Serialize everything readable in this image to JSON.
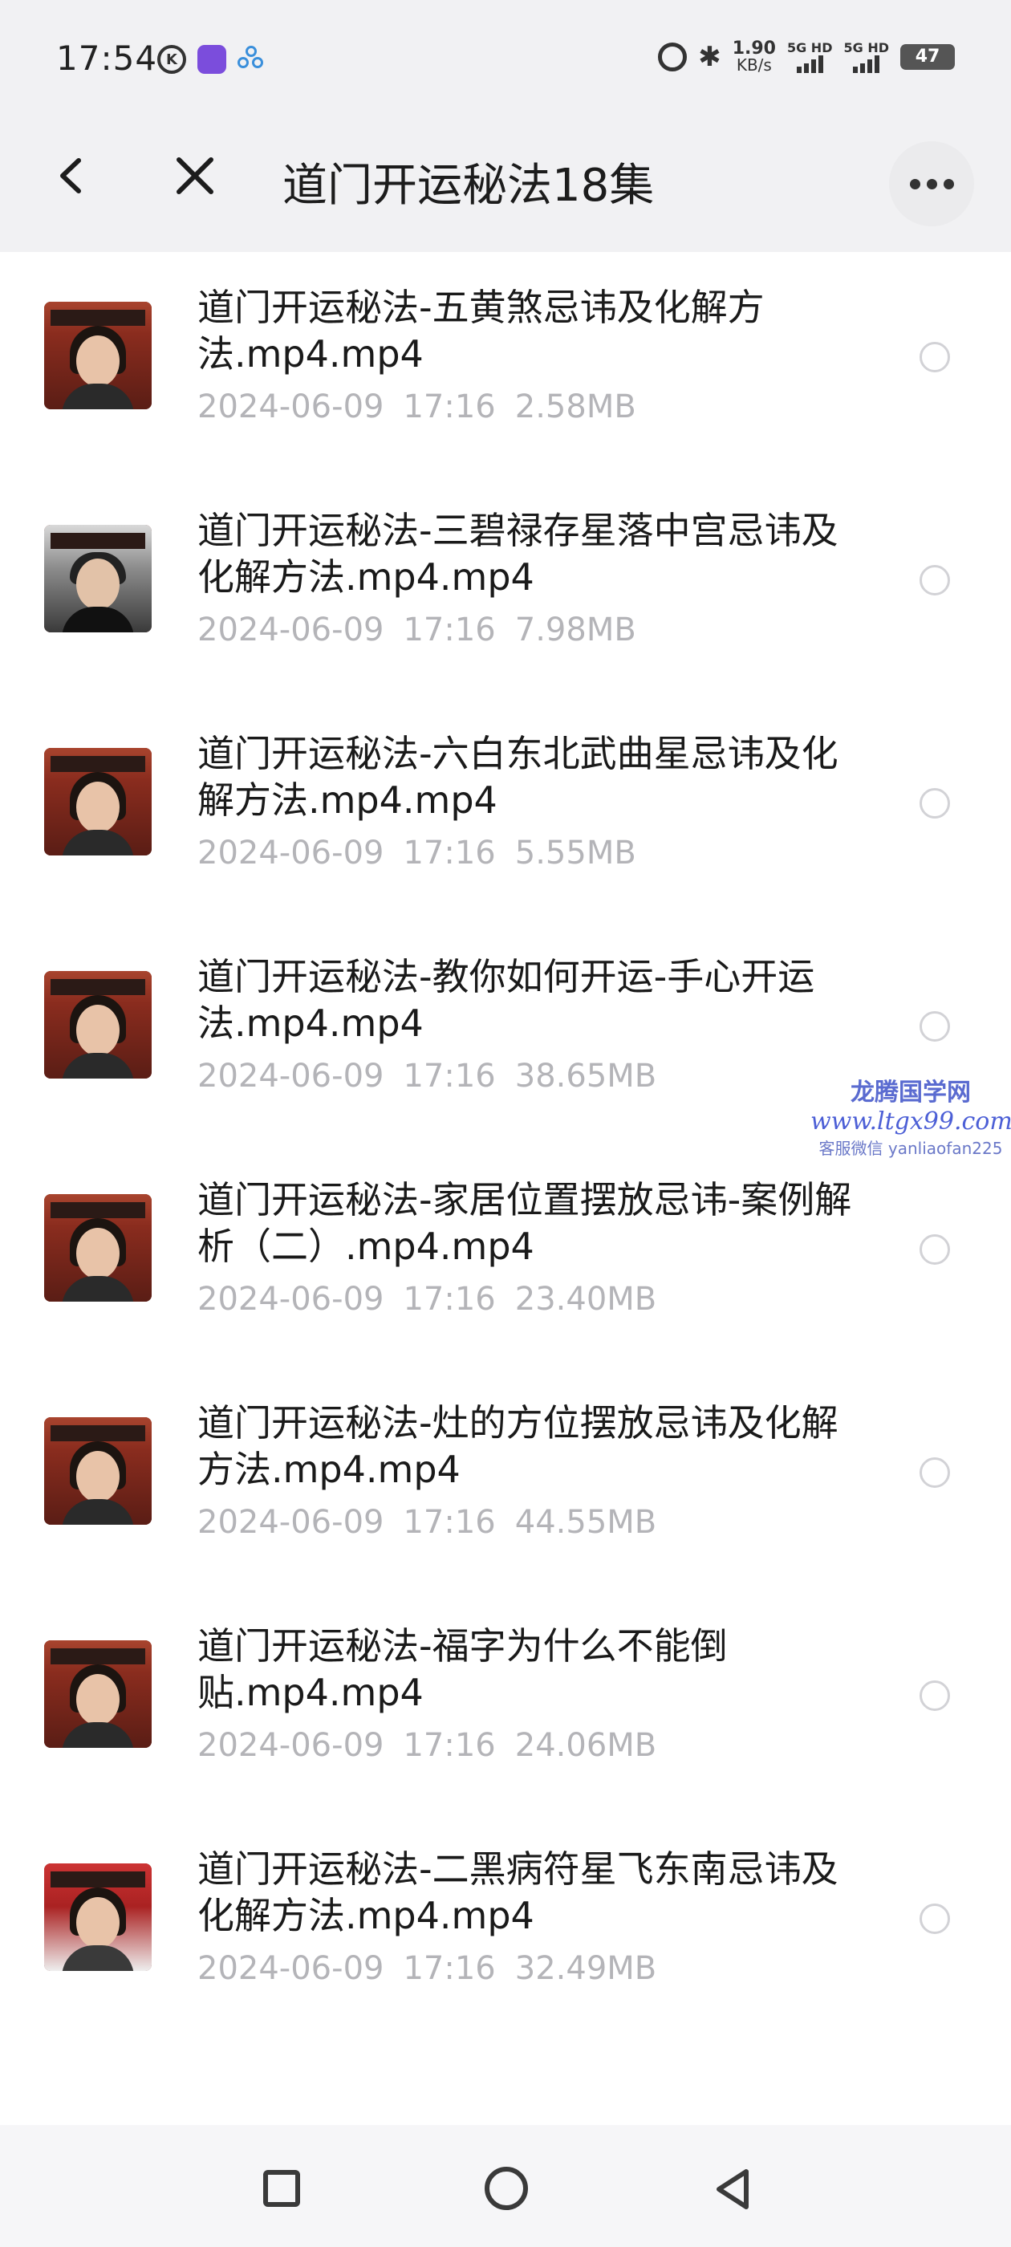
{
  "status_bar": {
    "time": "17:54",
    "network_speed_value": "1.90",
    "network_speed_unit": "KB/s",
    "signal_1_label": "5G HD",
    "signal_2_label": "5G HD",
    "battery": "47",
    "icons": [
      "k-circle-icon",
      "app-icon",
      "flower-icon",
      "alarm-icon",
      "bluetooth-icon",
      "signal-icon",
      "battery-icon"
    ]
  },
  "header": {
    "title": "道门开运秘法18集"
  },
  "files": [
    {
      "name": "道门开运秘法-五黄煞忌讳及化解方法.mp4.mp4",
      "date": "2024-06-09",
      "time": "17:16",
      "size": "2.58MB"
    },
    {
      "name": "道门开运秘法-三碧禄存星落中宫忌讳及化解方法.mp4.mp4",
      "date": "2024-06-09",
      "time": "17:16",
      "size": "7.98MB"
    },
    {
      "name": "道门开运秘法-六白东北武曲星忌讳及化解方法.mp4.mp4",
      "date": "2024-06-09",
      "time": "17:16",
      "size": "5.55MB"
    },
    {
      "name": "道门开运秘法-教你如何开运-手心开运法.mp4.mp4",
      "date": "2024-06-09",
      "time": "17:16",
      "size": "38.65MB"
    },
    {
      "name": "道门开运秘法-家居位置摆放忌讳-案例解析（二）.mp4.mp4",
      "date": "2024-06-09",
      "time": "17:16",
      "size": "23.40MB"
    },
    {
      "name": "道门开运秘法-灶的方位摆放忌讳及化解方法.mp4.mp4",
      "date": "2024-06-09",
      "time": "17:16",
      "size": "44.55MB"
    },
    {
      "name": "道门开运秘法-福字为什么不能倒贴.mp4.mp4",
      "date": "2024-06-09",
      "time": "17:16",
      "size": "24.06MB"
    },
    {
      "name": "道门开运秘法-二黑病符星飞东南忌讳及化解方法.mp4.mp4",
      "date": "2024-06-09",
      "time": "17:16",
      "size": "32.49MB"
    }
  ],
  "watermark": {
    "title": "龙腾国学网",
    "url": "www.ltgx99.com",
    "contact": "客服微信 yanliaofan225"
  }
}
